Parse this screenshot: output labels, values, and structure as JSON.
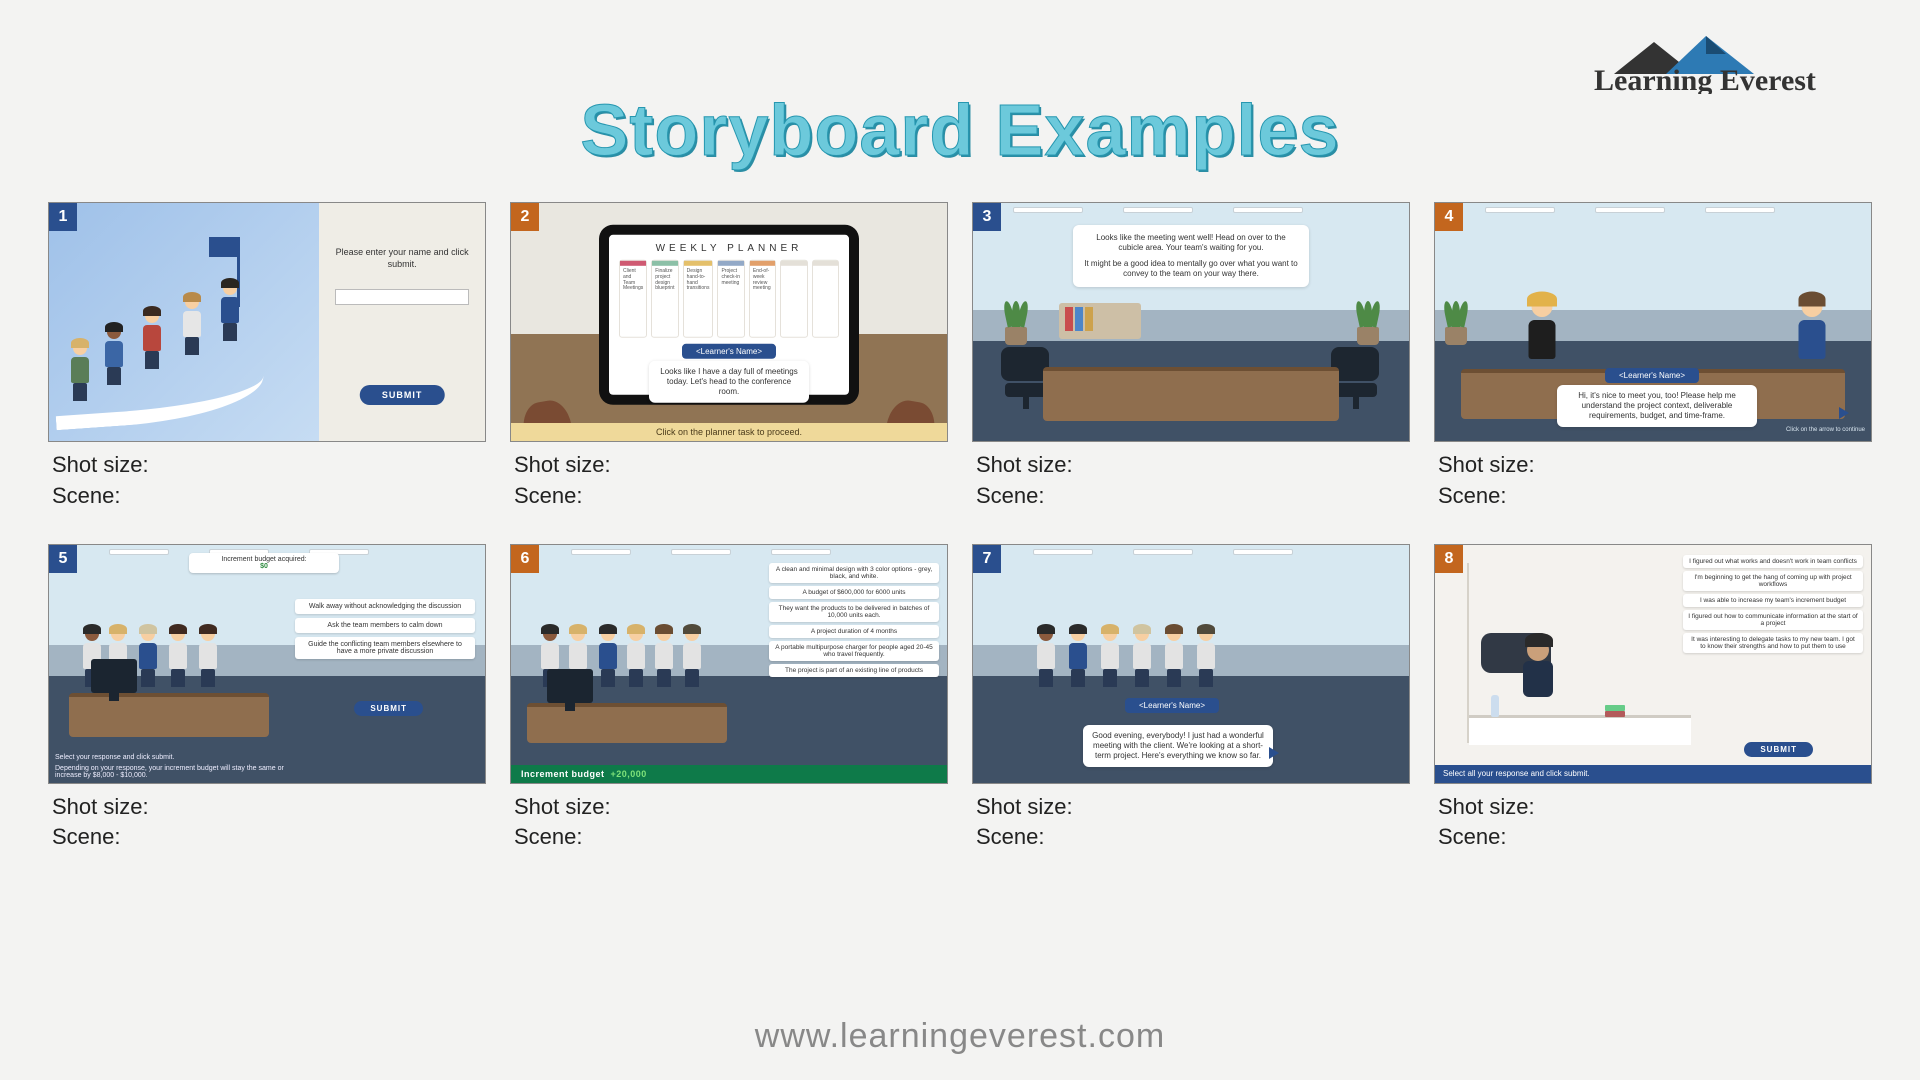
{
  "brand": {
    "name": "Learning Everest",
    "colorDark": "#2a4f8e",
    "colorLight": "#6ec2df"
  },
  "title": "Storyboard Examples",
  "url": "www.learningeverest.com",
  "labels": {
    "shot": "Shot size:",
    "scene": "Scene:",
    "submit": "SUBMIT",
    "learner": "<Learner's Name>",
    "increment": "Increment budget",
    "amount": "+20,000"
  },
  "panels": [
    {
      "num": "1",
      "color": "blue",
      "p1": {
        "prompt": "Please enter your name and click submit."
      }
    },
    {
      "num": "2",
      "color": "orange",
      "p2": {
        "plannerTitle": "WEEKLY PLANNER",
        "dialog": "Looks like I have a day full of meetings today. Let's head to the conference room.",
        "footer": "Click on the planner task to proceed.",
        "cols": [
          {
            "c": "#cf5a72",
            "t": "Client and Team Meetings"
          },
          {
            "c": "#8cc0a7",
            "t": "Finalize project design blueprint"
          },
          {
            "c": "#e4c06b",
            "t": "Design hand-to-hand transitions"
          },
          {
            "c": "#93a9c7",
            "t": "Project check-in meeting"
          },
          {
            "c": "#e2a06b",
            "t": "End-of-week review meeting"
          }
        ]
      }
    },
    {
      "num": "3",
      "color": "blue",
      "p3": {
        "l1": "Looks like the meeting went well! Head on over to the cubicle area. Your team's waiting for you.",
        "l2": "It might be a good idea to mentally go over what you want to convey to the team on your way there."
      }
    },
    {
      "num": "4",
      "color": "orange",
      "p4": {
        "dialog": "Hi, it's nice to meet you, too! Please help me understand the project context, deliverable requirements, budget, and time-frame.",
        "cta": "Click on the arrow to continue"
      }
    },
    {
      "num": "5",
      "color": "blue",
      "p5": {
        "budgetLabel": "Increment budget acquired:",
        "budgetVal": "$0",
        "opts": [
          "Walk away without acknowledging the discussion",
          "Ask the team members to calm down",
          "Guide the conflicting team members elsewhere to have a more private discussion"
        ],
        "foot1": "Select your response and click submit.",
        "foot2": "Depending on your response, your increment budget will stay the same or increase by $8,000 - $10,000."
      }
    },
    {
      "num": "6",
      "color": "orange",
      "p6": {
        "items": [
          "A clean and minimal design with 3 color options - grey, black, and white.",
          "A budget of $600,000 for 6000 units",
          "They want the products to be delivered in batches of 10,000 units each.",
          "A project duration of 4 months",
          "A portable multipurpose charger for people aged 20-45 who travel frequently.",
          "The project is part of an existing line of products"
        ]
      }
    },
    {
      "num": "7",
      "color": "blue",
      "p7": {
        "dialog": "Good evening, everybody! I just had a wonderful meeting with the client. We're looking at a short-term project. Here's everything we know so far."
      }
    },
    {
      "num": "8",
      "color": "orange",
      "p8": {
        "items": [
          "I figured out what works and doesn't work in team conflicts",
          "I'm beginning to get the hang of coming up with project workflows",
          "I was able to increase my team's increment budget",
          "I figured out how to communicate information at the start of a project",
          "It was interesting to delegate tasks to my new team. I got to know their strengths and how to put them to use"
        ],
        "foot": "Select all your response and click submit."
      }
    }
  ]
}
